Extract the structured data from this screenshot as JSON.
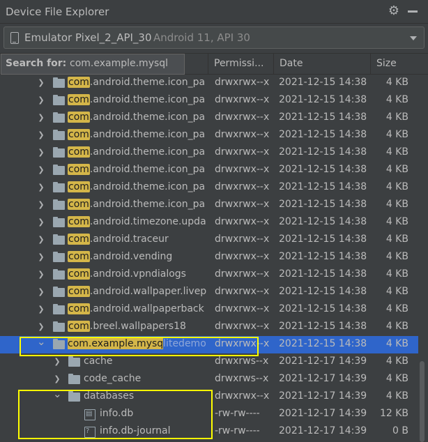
{
  "window": {
    "title": "Device File Explorer",
    "icons": {
      "settings": "gear-icon",
      "minimize": "minimize-icon"
    }
  },
  "device": {
    "name": "Emulator Pixel_2_API_30",
    "api": "Android 11, API 30"
  },
  "search": {
    "label": "Search for:",
    "value": "com.example.mysql"
  },
  "columns": {
    "permissions": "Permissi...",
    "date": "Date",
    "size": "Size"
  },
  "rows": [
    {
      "hl": "com",
      "rest": ".android.theme.icon_pa",
      "perm": "drwxrwx--x",
      "date": "2021-12-15 14:38",
      "size": "4 KB"
    },
    {
      "hl": "com",
      "rest": ".android.theme.icon_pa",
      "perm": "drwxrwx--x",
      "date": "2021-12-15 14:38",
      "size": "4 KB"
    },
    {
      "hl": "com",
      "rest": ".android.theme.icon_pa",
      "perm": "drwxrwx--x",
      "date": "2021-12-15 14:38",
      "size": "4 KB"
    },
    {
      "hl": "com",
      "rest": ".android.theme.icon_pa",
      "perm": "drwxrwx--x",
      "date": "2021-12-15 14:38",
      "size": "4 KB"
    },
    {
      "hl": "com",
      "rest": ".android.theme.icon_pa",
      "perm": "drwxrwx--x",
      "date": "2021-12-15 14:38",
      "size": "4 KB"
    },
    {
      "hl": "com",
      "rest": ".android.theme.icon_pa",
      "perm": "drwxrwx--x",
      "date": "2021-12-15 14:38",
      "size": "4 KB"
    },
    {
      "hl": "com",
      "rest": ".android.theme.icon_pa",
      "perm": "drwxrwx--x",
      "date": "2021-12-15 14:38",
      "size": "4 KB"
    },
    {
      "hl": "com",
      "rest": ".android.theme.icon_pa",
      "perm": "drwxrwx--x",
      "date": "2021-12-15 14:38",
      "size": "4 KB"
    },
    {
      "hl": "com",
      "rest": ".android.timezone.upda",
      "perm": "drwxrwx--x",
      "date": "2021-12-15 14:38",
      "size": "4 KB"
    },
    {
      "hl": "com",
      "rest": ".android.traceur",
      "perm": "drwxrwx--x",
      "date": "2021-12-15 14:38",
      "size": "4 KB"
    },
    {
      "hl": "com",
      "rest": ".android.vending",
      "perm": "drwxrwx--x",
      "date": "2021-12-15 14:38",
      "size": "4 KB"
    },
    {
      "hl": "com",
      "rest": ".android.vpndialogs",
      "perm": "drwxrwx--x",
      "date": "2021-12-15 14:38",
      "size": "4 KB"
    },
    {
      "hl": "com",
      "rest": ".android.wallpaper.livep",
      "perm": "drwxrwx--x",
      "date": "2021-12-15 14:38",
      "size": "4 KB"
    },
    {
      "hl": "com",
      "rest": ".android.wallpaperback",
      "perm": "drwxrwx--x",
      "date": "2021-12-15 14:38",
      "size": "4 KB"
    },
    {
      "hl": "com",
      "rest": ".breel.wallpapers18",
      "perm": "drwxrwx--x",
      "date": "2021-12-15 14:38",
      "size": "4 KB"
    }
  ],
  "selected_row": {
    "hl": "com.example.mysq",
    "rest": "litedemo",
    "perm": "drwxrwx--x",
    "date": "2021-12-15 14:38",
    "size": "4 KB"
  },
  "children": [
    {
      "name": "cache",
      "perm": "drwxrws--x",
      "date": "2021-12-17 14:39",
      "size": "4 KB"
    },
    {
      "name": "code_cache",
      "perm": "drwxrws--x",
      "date": "2021-12-17 14:39",
      "size": "4 KB"
    },
    {
      "name": "databases",
      "perm": "drwxrwx--x",
      "date": "2021-12-17 14:39",
      "size": "4 KB"
    }
  ],
  "files": [
    {
      "name": "info.db",
      "perm": "-rw-rw----",
      "date": "2021-12-17 14:39",
      "size": "12 KB",
      "icon": "database-file-icon"
    },
    {
      "name": "info.db-journal",
      "perm": "-rw-rw----",
      "date": "2021-12-17 14:39",
      "size": "0 B",
      "icon": "unknown-file-icon"
    }
  ],
  "colors": {
    "background": "#3c3f41",
    "selection": "#2f65ca",
    "search_highlight": "#d4b649",
    "annotation": "#ffff00"
  }
}
